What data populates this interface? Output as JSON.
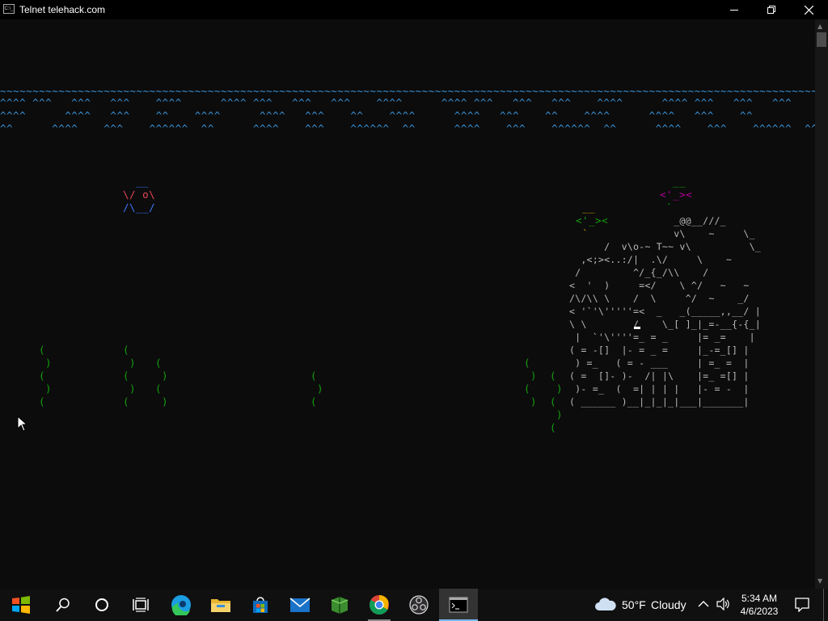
{
  "window": {
    "title": "Telnet telehack.com",
    "app_icon_text": "C:\\_"
  },
  "terminal": {
    "water": {
      "surface": "~~~~~~~~~~~~~~~~~~~~~~~~~~~~~~~~~~~~~~~~~~~~~~~~~~~~~~~~~~~~~~~~~~~~~~~~~~~~~~~~~~~~~~~~~~~~~~~~~~~~~~~~~~~~~~~~~~~~~~~~~~~~~~~~~~~~~~~~~~~~~",
      "wave1": "^^^^ ^^^   ^^^   ^^^    ^^^^      ^^^^ ^^^   ^^^   ^^^    ^^^^      ^^^^ ^^^   ^^^   ^^^    ^^^^      ^^^^ ^^^   ^^^   ^^^",
      "wave2": "^^^^      ^^^^   ^^^    ^^    ^^^^      ^^^^   ^^^    ^^    ^^^^      ^^^^   ^^^    ^^    ^^^^      ^^^^   ^^^    ^^",
      "wave3": "^^      ^^^^    ^^^    ^^^^^^  ^^      ^^^^    ^^^    ^^^^^^  ^^      ^^^^    ^^^    ^^^^^^  ^^      ^^^^    ^^^    ^^^^^^  ^^"
    },
    "fish_hex_top": " __",
    "fish_hex_1": "\\/ o\\",
    "fish_hex_2": "/\\__/",
    "fish_small_1": "  __",
    "fish_small_2": "<'_><",
    "fish_small_3": " `",
    "fish_mid_1": " __",
    "fish_mid_2": "<'_><",
    "fish_mid_3": " `",
    "seaweed": [
      "(\n )\n(\n )\n(",
      "(\n )\n(\n )\n(",
      "(\n )\n(\n )",
      "(\n )\n(",
      "(\n )\n(\n )",
      "(\n )\n(\n )\n(",
      "(\n )\n(\n )\n(",
      "(\n )\n(\n )\n("
    ],
    "castle": "                  _@@__///_\n                  v\\    ~     \\_\n      /  v\\o-~ T~~ v\\          \\_\n  ,<;><..:/|  .\\/     \\    ~\n /         ^/_{_/\\\\    /\n<  '  )     =</    \\ ^/   ~   ~\n/\\/\\\\ \\    /  \\     ^/  ~    _/\n< '`'\\'''''=<  _   _(_____,,__/ |\n\\ \\        /    \\_[ ]_|_=-__{-{_|\n |  `'\\''''=_ = _     |= _=    |\n( = -[]  |- = _ =     |_-=_[] |\n ) =_   ( = - ___     | =_ =  |\n( =  []- )-  /| |\\    |=_ =[] |\n )- =_  (  =| | | |   |- = -  |\n( ______ )__|_|_|_|___|_______|"
  },
  "scrollbar": {
    "up": "▲",
    "down": "▼"
  },
  "taskbar": {
    "weather": {
      "temp": "50°F",
      "condition": "Cloudy"
    },
    "clock": {
      "time": "5:34 AM",
      "date": "4/6/2023"
    },
    "apps": [
      "start",
      "search",
      "cortana",
      "task-view",
      "edge",
      "file-explorer",
      "microsoft-store",
      "mail",
      "minecraft",
      "chrome",
      "obs",
      "terminal"
    ]
  },
  "colors": {
    "water": "#3a96dd",
    "terminal_bg": "#0c0c0c",
    "seaweed": "#13a10e",
    "fish_red": "#e74856",
    "fish_blue": "#3b78ff",
    "fish_yellow": "#c19c00",
    "fish_magenta": "#b4009e",
    "castle_white": "#cccccc",
    "accent": "#76b9ed"
  }
}
